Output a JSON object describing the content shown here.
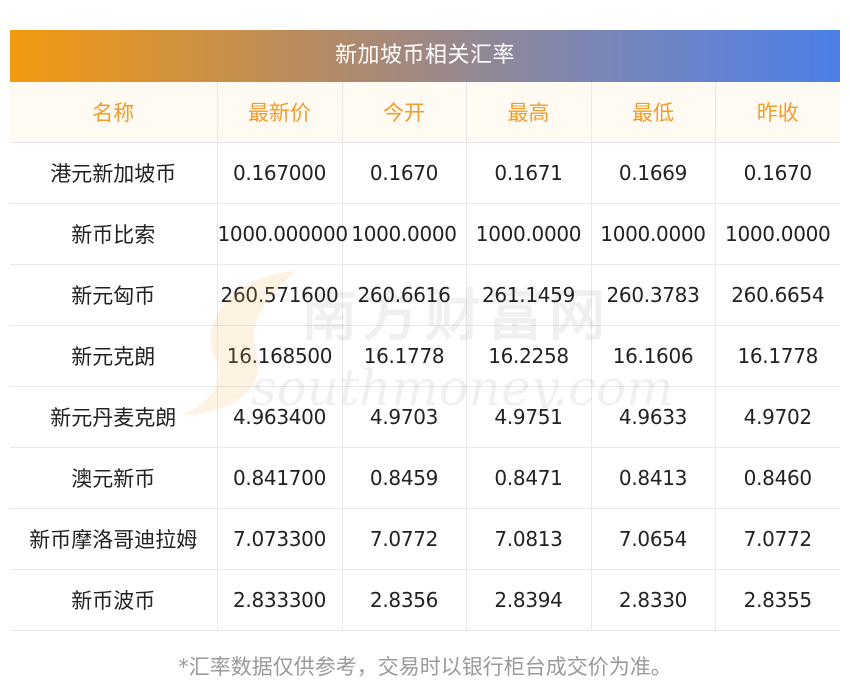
{
  "title": "新加坡币相关汇率",
  "table": {
    "headers": [
      "名称",
      "最新价",
      "今开",
      "最高",
      "最低",
      "昨收"
    ],
    "rows": [
      [
        "港元新加坡币",
        "0.167000",
        "0.1670",
        "0.1671",
        "0.1669",
        "0.1670"
      ],
      [
        "新币比索",
        "1000.000000",
        "1000.0000",
        "1000.0000",
        "1000.0000",
        "1000.0000"
      ],
      [
        "新元匈币",
        "260.571600",
        "260.6616",
        "261.1459",
        "260.3783",
        "260.6654"
      ],
      [
        "新元克朗",
        "16.168500",
        "16.1778",
        "16.2258",
        "16.1606",
        "16.1778"
      ],
      [
        "新元丹麦克朗",
        "4.963400",
        "4.9703",
        "4.9751",
        "4.9633",
        "4.9702"
      ],
      [
        "澳元新币",
        "0.841700",
        "0.8459",
        "0.8471",
        "0.8413",
        "0.8460"
      ],
      [
        "新币摩洛哥迪拉姆",
        "7.073300",
        "7.0772",
        "7.0813",
        "7.0654",
        "7.0772"
      ],
      [
        "新币波币",
        "2.833300",
        "2.8356",
        "2.8394",
        "2.8330",
        "2.8355"
      ]
    ]
  },
  "footnote": "*汇率数据仅供参考，交易时以银行柜台成交价为准。",
  "watermark": {
    "cn": "南方财富网",
    "en": "southmoney.com",
    "icon": "southmoney-logo-s"
  },
  "colors": {
    "title_gradient_start": "#f39a0e",
    "title_gradient_end": "#4d7fe8",
    "header_text": "#f19d2b",
    "header_bg": "#fffaf2",
    "footnote_text": "#9a9a9a"
  }
}
